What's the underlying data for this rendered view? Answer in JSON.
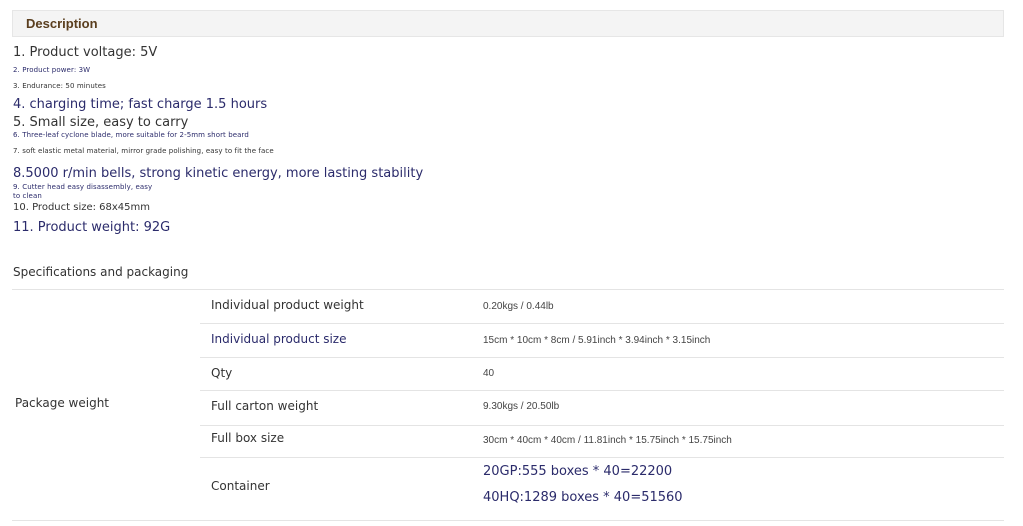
{
  "description": {
    "header": "Description",
    "lines": [
      "1. Product voltage: 5V",
      "2. Product power: 3W",
      "3. Endurance: 50 minutes",
      "4. charging time; fast charge 1.5 hours",
      "5. Small size, easy to carry",
      "6. Three-leaf cyclone blade, more suitable for 2-5mm short beard",
      "7. soft elastic metal material, mirror grade polishing, easy to fit the face",
      "8.5000 r/min bells, strong kinetic energy, more lasting stability",
      "9. Cutter head easy disassembly, easy to clean",
      "10. Product size: 68x45mm",
      "11. Product weight: 92G"
    ]
  },
  "specs": {
    "title": "Specifications and packaging",
    "group_label": "Package weight",
    "rows": [
      {
        "label": "Individual product weight",
        "value": "0.20kgs / 0.44lb"
      },
      {
        "label": "Individual product size",
        "value": "15cm * 10cm * 8cm / 5.91inch * 3.94inch * 3.15inch"
      },
      {
        "label": "Qty",
        "value": "40"
      },
      {
        "label": "Full carton weight",
        "value": "9.30kgs / 20.50lb"
      },
      {
        "label": "Full box size",
        "value": "30cm * 40cm * 40cm / 11.81inch * 15.75inch * 15.75inch"
      },
      {
        "label": "Container",
        "value": "20GP:555 boxes * 40=22200",
        "value2": "40HQ:1289 boxes * 40=51560"
      }
    ]
  }
}
